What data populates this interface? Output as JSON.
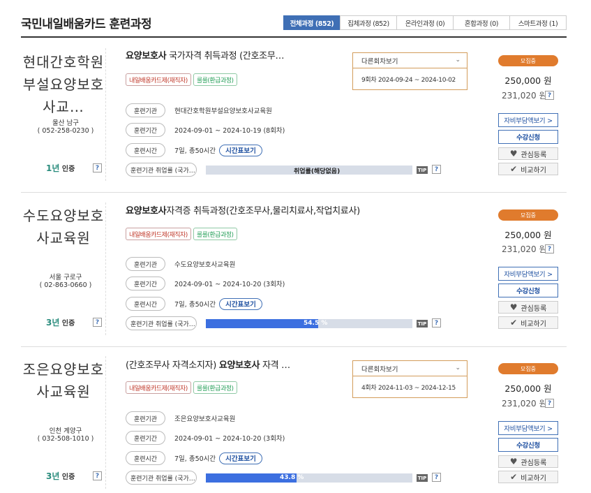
{
  "header": {
    "title": "국민내일배움카드 훈련과정",
    "tabs": [
      {
        "label": "전체과정 (852)",
        "active": true
      },
      {
        "label": "집체과정 (852)",
        "active": false
      },
      {
        "label": "온라인과정 (0)",
        "active": false
      },
      {
        "label": "혼합과정 (0)",
        "active": false
      },
      {
        "label": "스마트과정 (1)",
        "active": false
      }
    ]
  },
  "labels": {
    "institution": "훈련기관",
    "period": "훈련기간",
    "time": "훈련시간",
    "employment": "훈련기관 취업률 (국가…",
    "time_table": "시간표보기",
    "tip": "TIP",
    "help": "?",
    "other_rounds": "다른회차보기",
    "self_pay": "자비부담액보기 >",
    "apply": "수강신청",
    "wishlist": "관심등록",
    "compare": "비교하기",
    "rating_suffix": "인증",
    "currency": "원"
  },
  "courses": [
    {
      "institution_name": "현대간호학원부설요양보호사교…",
      "region": "울산 남구",
      "phone": "( 052-258-0230 )",
      "rating_years": "1년",
      "title_bold": "요양보호사",
      "title_rest": " 국가자격 취득과정 (간호조무…",
      "badges": [
        "내일배움카드제(재직자)",
        "룰룰(환급과정)"
      ],
      "institution": "현대간호학원부설요양보호사교육원",
      "period": "2024-09-01 ~ 2024-10-19 (8회차)",
      "hours": "7일, 총50시간",
      "employment_text": "취업률(해당없음)",
      "employment_rate": null,
      "other_round": "9회차 2024-09-24 ~ 2024-10-02",
      "status": "모집중",
      "price": "250,000 원",
      "price_sub": "231,020 원"
    },
    {
      "institution_name": "수도요양보호사교육원",
      "region": "서울 구로구",
      "phone": "( 02-863-0660 )",
      "rating_years": "3년",
      "title_bold": "요양보호사",
      "title_rest": "자격증 취득과정(간호조무사,물리치료사,작업치료사)",
      "badges": [
        "내일배움카드제(재직자)",
        "룰룰(환급과정)"
      ],
      "institution": "수도요양보호사교육원",
      "period": "2024-09-01 ~ 2024-10-20 (3회차)",
      "hours": "7일, 총50시간",
      "employment_text": "54.5 %",
      "employment_rate": 54.5,
      "other_round": null,
      "status": "모집중",
      "price": "250,000 원",
      "price_sub": "231,020 원"
    },
    {
      "institution_name": "조은요양보호사교육원",
      "region": "인천 계양구",
      "phone": "( 032-508-1010 )",
      "rating_years": "3년",
      "title_bold": "요양보호사",
      "title_pre": "(간호조무사 자격소지자) ",
      "title_rest": " 자격 …",
      "badges": [
        "내일배움카드제(재직자)",
        "룰룰(환급과정)"
      ],
      "institution": "조은요양보호사교육원",
      "period": "2024-09-01 ~ 2024-10-20 (3회차)",
      "hours": "7일, 총50시간",
      "employment_text": "43.8 %",
      "employment_rate": 43.8,
      "other_round": "4회차 2024-11-03 ~ 2024-12-15",
      "status": "모집중",
      "price": "250,000 원",
      "price_sub": "231,020 원"
    }
  ]
}
